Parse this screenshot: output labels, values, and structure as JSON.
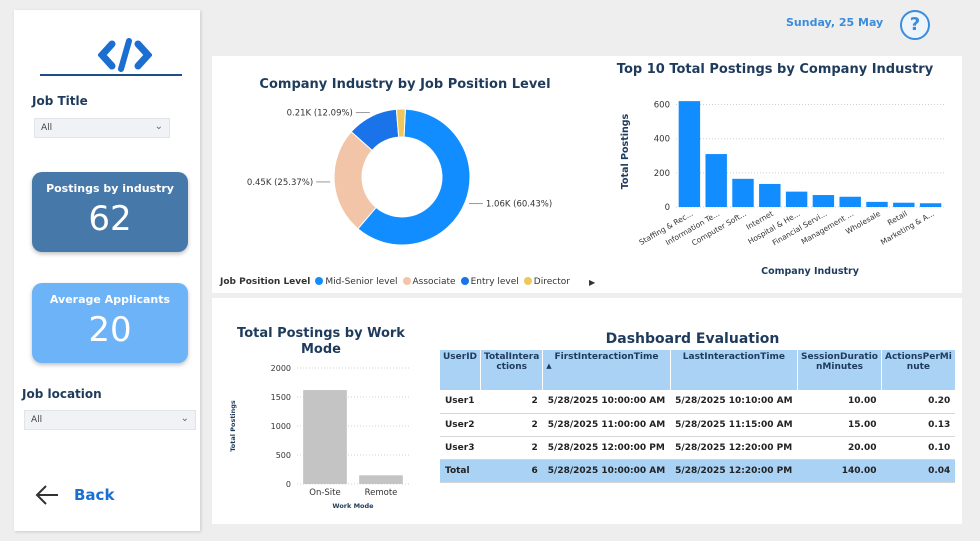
{
  "header": {
    "date": "Sunday, 25 May",
    "help_icon": "question-icon"
  },
  "sidebar": {
    "job_title": {
      "label": "Job Title",
      "value": "All"
    },
    "kpi_industry": {
      "label": "Postings by industry",
      "value": "62",
      "color": "#4679aa"
    },
    "kpi_applicants": {
      "label": "Average Applicants",
      "value": "20",
      "color": "#6cb4f7"
    },
    "job_location": {
      "label": "Job location",
      "value": "All"
    },
    "back_label": "Back"
  },
  "donut": {
    "title": "Company Industry by Job Position Level",
    "legend_title": "Job Position Level",
    "slices": [
      {
        "name": "Mid-Senior level",
        "value": 60.43,
        "label": "1.06K (60.43%)",
        "color": "#118dff"
      },
      {
        "name": "Associate",
        "value": 25.37,
        "label": "0.45K (25.37%)",
        "color": "#f2c4a8"
      },
      {
        "name": "Entry level",
        "value": 12.09,
        "label": "0.21K (12.09%)",
        "color": "#1a73e8"
      },
      {
        "name": "Director",
        "value": 2.11,
        "label": "",
        "color": "#f0c75e"
      }
    ]
  },
  "chart_data": [
    {
      "type": "bar",
      "title": "Top 10 Total Postings by Company Industry",
      "xlabel": "Company Industry",
      "ylabel": "Total Postings",
      "ylim": [
        0,
        650
      ],
      "yticks": [
        0,
        200,
        400,
        600
      ],
      "color": "#118dff",
      "categories": [
        "Staffing & Rec...",
        "Information Te...",
        "Computer Soft...",
        "Internet",
        "Hospital & He...",
        "Financial Servi...",
        "Management ...",
        "Wholesale",
        "Retail",
        "Marketing & A..."
      ],
      "values": [
        620,
        310,
        165,
        135,
        90,
        70,
        60,
        30,
        25,
        22
      ]
    },
    {
      "type": "bar",
      "title": "Total Postings by Work Mode",
      "xlabel": "Work Mode",
      "ylabel": "Total Postings",
      "ylim": [
        0,
        2000
      ],
      "yticks": [
        0,
        500,
        1000,
        1500,
        2000
      ],
      "color": "#c4c4c4",
      "categories": [
        "On-Site",
        "Remote"
      ],
      "values": [
        1620,
        150
      ]
    }
  ],
  "table": {
    "title": "Dashboard Evaluation",
    "columns": [
      "UserID",
      "TotalInteractions",
      "FirstInteractionTime",
      "LastInteractionTime",
      "SessionDurationMinutes",
      "ActionsPerMinute"
    ],
    "column_labels": [
      "UserID",
      "TotalIntera ctions",
      "FirstInteractionTime",
      "LastInteractionTime",
      "SessionDuratio nMinutes",
      "ActionsPerMi nute"
    ],
    "rows": [
      [
        "User1",
        "2",
        "5/28/2025 10:00:00 AM",
        "5/28/2025 10:10:00 AM",
        "10.00",
        "0.20"
      ],
      [
        "User2",
        "2",
        "5/28/2025 11:00:00 AM",
        "5/28/2025 11:15:00 AM",
        "15.00",
        "0.13"
      ],
      [
        "User3",
        "2",
        "5/28/2025 12:00:00 PM",
        "5/28/2025 12:20:00 PM",
        "20.00",
        "0.10"
      ]
    ],
    "total": [
      "Total",
      "6",
      "5/28/2025 10:00:00 AM",
      "5/28/2025 12:20:00 PM",
      "140.00",
      "0.04"
    ]
  }
}
